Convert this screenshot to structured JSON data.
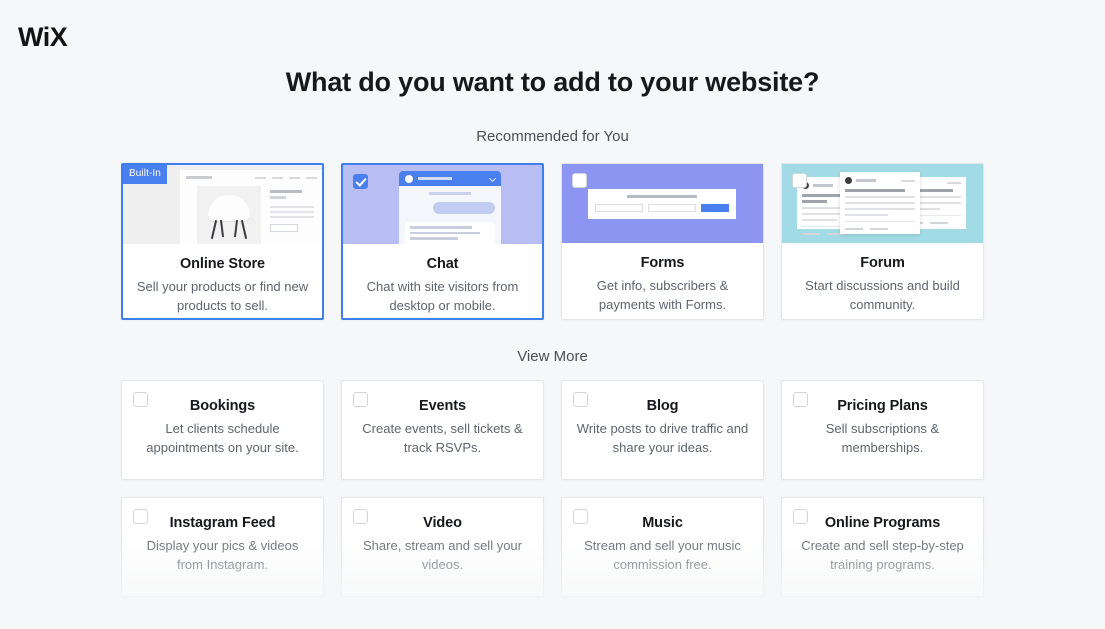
{
  "brand": {
    "logo": "WiX"
  },
  "header": {
    "title": "What do you want to add to your website?"
  },
  "sections": {
    "recommended_label": "Recommended for You",
    "view_more_label": "View More"
  },
  "badges": {
    "built_in": "Built-In"
  },
  "colors": {
    "accent_blue": "#4a7ff0",
    "selected_border": "#3d7fed",
    "page_background": "#f6f7f8",
    "card_background": "#ffffff",
    "thumb_store": "#efeff0",
    "thumb_chat": "#b8bdf4",
    "thumb_forms": "#8d95f2",
    "thumb_forum": "#a2dbe5",
    "title_text": "#16181c",
    "desc_text": "#5e646d"
  },
  "recommended": [
    {
      "id": "online-store",
      "title": "Online Store",
      "desc": "Sell your products or find new products to sell.",
      "selected": true,
      "checked": false,
      "badge": "Built-In"
    },
    {
      "id": "chat",
      "title": "Chat",
      "desc": "Chat with site visitors from desktop or mobile.",
      "selected": true,
      "checked": true,
      "badge": ""
    },
    {
      "id": "forms",
      "title": "Forms",
      "desc": "Get info, subscribers & payments with Forms.",
      "selected": false,
      "checked": false,
      "badge": ""
    },
    {
      "id": "forum",
      "title": "Forum",
      "desc": "Start discussions and build community.",
      "selected": false,
      "checked": false,
      "badge": ""
    }
  ],
  "view_more": [
    {
      "id": "bookings",
      "title": "Bookings",
      "desc": "Let clients schedule appointments on your site.",
      "checked": false
    },
    {
      "id": "events",
      "title": "Events",
      "desc": "Create events, sell tickets & track RSVPs.",
      "checked": false
    },
    {
      "id": "blog",
      "title": "Blog",
      "desc": "Write posts to drive traffic and share your ideas.",
      "checked": false
    },
    {
      "id": "pricing-plans",
      "title": "Pricing Plans",
      "desc": "Sell subscriptions & memberships.",
      "checked": false
    },
    {
      "id": "instagram-feed",
      "title": "Instagram Feed",
      "desc": "Display your pics & videos from Instagram.",
      "checked": false
    },
    {
      "id": "video",
      "title": "Video",
      "desc": "Share, stream and sell your videos.",
      "checked": false
    },
    {
      "id": "music",
      "title": "Music",
      "desc": "Stream and sell your music commission free.",
      "checked": false
    },
    {
      "id": "online-programs",
      "title": "Online Programs",
      "desc": "Create and sell step-by-step training programs.",
      "checked": false
    }
  ]
}
